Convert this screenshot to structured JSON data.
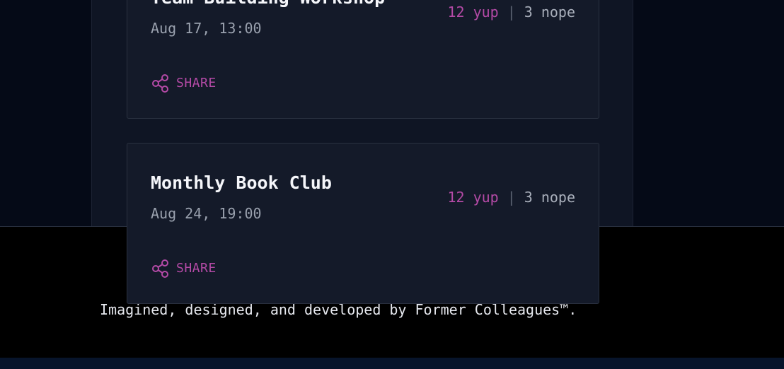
{
  "events": [
    {
      "title": "Team Building Workshop",
      "date": "Aug 17, 13:00",
      "yes": "12 yup",
      "separator": "|",
      "no": "3 nope",
      "share_label": "SHARE"
    },
    {
      "title": "Monthly Book Club",
      "date": "Aug 24, 19:00",
      "yes": "12 yup",
      "separator": "|",
      "no": "3 nope",
      "share_label": "SHARE"
    }
  ],
  "footer": {
    "credit": "Imagined, designed, and developed by Former Colleagues™."
  },
  "colors": {
    "accent": "#b44aa6",
    "card_bg": "#141a29",
    "page_bg": "#050a17",
    "footer_bg": "#000000"
  },
  "icons": {
    "share": "share-icon"
  }
}
